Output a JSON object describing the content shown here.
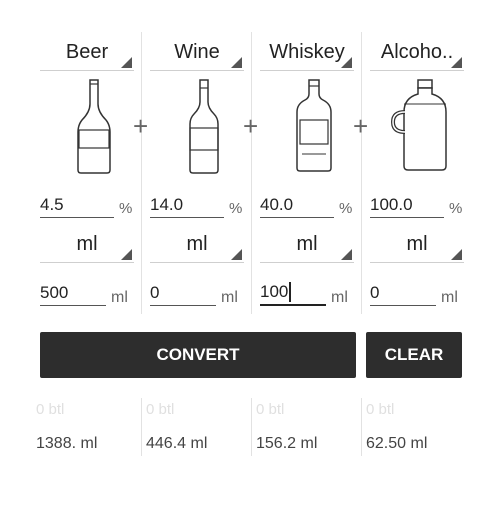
{
  "columns": [
    {
      "drink": "Beer",
      "percent": "4.5",
      "percent_unit": "%",
      "volume_unit": "ml",
      "amount": "500",
      "amount_unit": "ml",
      "result_btl": "0 btl",
      "result_ml": "1388. ml",
      "icon": "beer-bottle-icon"
    },
    {
      "drink": "Wine",
      "percent": "14.0",
      "percent_unit": "%",
      "volume_unit": "ml",
      "amount": "0",
      "amount_unit": "ml",
      "result_btl": "0 btl",
      "result_ml": "446.4 ml",
      "icon": "wine-bottle-icon"
    },
    {
      "drink": "Whiskey",
      "percent": "40.0",
      "percent_unit": "%",
      "volume_unit": "ml",
      "amount": "100",
      "amount_unit": "ml",
      "result_btl": "0 btl",
      "result_ml": "156.2 ml",
      "icon": "whiskey-bottle-icon"
    },
    {
      "drink": "Alcoho..",
      "percent": "100.0",
      "percent_unit": "%",
      "volume_unit": "ml",
      "amount": "0",
      "amount_unit": "ml",
      "result_btl": "0 btl",
      "result_ml": "62.50 ml",
      "icon": "alcohol-jug-icon"
    }
  ],
  "operators": {
    "plus": "+"
  },
  "buttons": {
    "convert": "CONVERT",
    "clear": "CLEAR"
  },
  "colors": {
    "button_bg": "#2d2d2d",
    "button_text": "#ffffff"
  }
}
